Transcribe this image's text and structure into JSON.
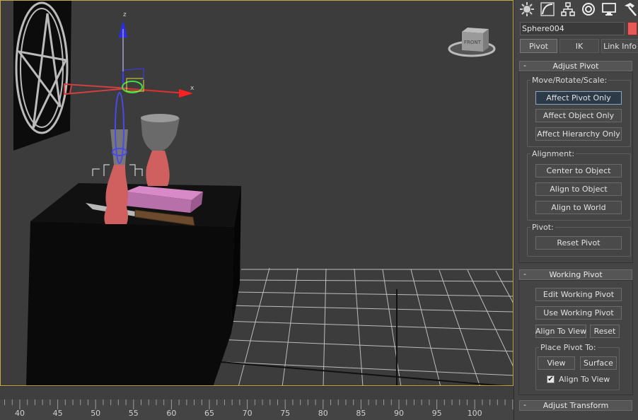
{
  "viewport": {
    "viewcube_label": "FRONT",
    "axis_labels": {
      "z": "z",
      "x": "x"
    }
  },
  "timeline": {
    "ticks": [
      "40",
      "45",
      "50",
      "55",
      "60",
      "65",
      "70",
      "75",
      "80",
      "85",
      "90",
      "95",
      "100"
    ]
  },
  "command_panel": {
    "tab_icons": [
      "sun-gear-icon",
      "curve-modify-icon",
      "hierarchy-icon",
      "motion-icon",
      "display-monitor-icon",
      "utilities-hammer-icon"
    ],
    "object_name": "Sphere004",
    "object_color": "#e85a5a",
    "hierarchy_tabs": [
      "Pivot",
      "IK",
      "Link Info"
    ],
    "active_hierarchy_tab": "Pivot",
    "adjust_pivot": {
      "title": "Adjust Pivot",
      "collapse_sign": "-",
      "move_group_label": "Move/Rotate/Scale:",
      "affect_pivot_only": "Affect Pivot Only",
      "affect_object_only": "Affect Object Only",
      "affect_hierarchy_only": "Affect Hierarchy Only",
      "alignment_group_label": "Alignment:",
      "center_to_object": "Center to Object",
      "align_to_object": "Align to Object",
      "align_to_world": "Align to World",
      "pivot_group_label": "Pivot:",
      "reset_pivot": "Reset Pivot"
    },
    "working_pivot": {
      "title": "Working Pivot",
      "collapse_sign": "-",
      "edit_working_pivot": "Edit Working Pivot",
      "use_working_pivot": "Use Working Pivot",
      "align_to_view": "Align To View",
      "reset": "Reset",
      "place_pivot_group_label": "Place Pivot To:",
      "view": "View",
      "surface": "Surface",
      "align_to_view_checkbox": "Align To View",
      "align_to_view_checked": true,
      "check_glyph": "✔"
    },
    "adjust_transform": {
      "title": "Adjust Transform",
      "collapse_sign": "-"
    }
  },
  "colors": {
    "accent_active": "#8aa6c4",
    "viewport_border": "#c8a84a"
  }
}
